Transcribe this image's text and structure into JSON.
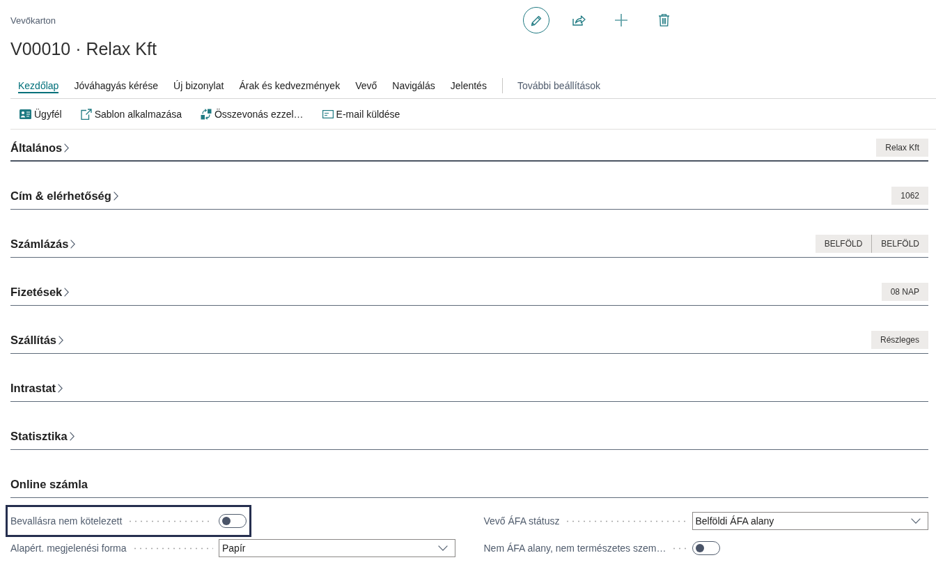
{
  "page": {
    "caption": "Vevőkarton",
    "title": "V00010 · Relax Kft"
  },
  "header_actions": [
    {
      "kind": "edit",
      "selected": true
    },
    {
      "kind": "share",
      "selected": false
    },
    {
      "kind": "new",
      "selected": false
    },
    {
      "kind": "delete",
      "selected": false
    }
  ],
  "tabs": [
    {
      "label": "Kezdőlap",
      "selected": true
    },
    {
      "label": "Jóváhagyás kérése",
      "selected": false
    },
    {
      "label": "Új bizonylat",
      "selected": false
    },
    {
      "label": "Árak és kedvezmények",
      "selected": false
    },
    {
      "label": "Vevő",
      "selected": false
    },
    {
      "label": "Navigálás",
      "selected": false
    },
    {
      "label": "Jelentés",
      "selected": false
    }
  ],
  "more_tab": {
    "label": "További beállítások"
  },
  "actions": [
    {
      "kind": "customer",
      "label": "Ügyfél"
    },
    {
      "kind": "template",
      "label": "Sablon alkalmazása"
    },
    {
      "kind": "merge",
      "label": "Összevonás ezzel…"
    },
    {
      "kind": "email",
      "label": "E-mail küldése"
    }
  ],
  "sections": [
    {
      "title": "Általános",
      "expanded": false,
      "selected": true,
      "summary": [
        "Relax Kft"
      ]
    },
    {
      "title": "Cím & elérhetőség",
      "expanded": false,
      "selected": false,
      "summary": [
        "1062"
      ]
    },
    {
      "title": "Számlázás",
      "expanded": false,
      "selected": false,
      "summary": [
        "BELFÖLD",
        "BELFÖLD"
      ]
    },
    {
      "title": "Fizetések",
      "expanded": false,
      "selected": false,
      "summary": [
        "08 NAP"
      ]
    },
    {
      "title": "Szállítás",
      "expanded": false,
      "selected": false,
      "summary": [
        "Részleges"
      ]
    },
    {
      "title": "Intrastat",
      "expanded": false,
      "selected": false
    },
    {
      "title": "Statisztika",
      "expanded": false,
      "selected": false
    },
    {
      "title": "Online számla",
      "expanded": true,
      "selected": false,
      "field_columns": [
        {
          "fields": [
            {
              "kind": "toggle",
              "label": "Bevallásra nem kötelezett",
              "on": false,
              "focused": true
            },
            {
              "kind": "select",
              "label": "Alapért. megjelenési forma",
              "value": "Papír",
              "focused": false
            }
          ]
        },
        {
          "fields": [
            {
              "kind": "select",
              "label": "Vevő ÁFA státusz",
              "value": "Belföldi ÁFA alany",
              "focused": false
            },
            {
              "kind": "toggle",
              "label": "Nem ÁFA alany, nem természetes szem…",
              "on": false,
              "focused": false
            }
          ]
        }
      ]
    }
  ]
}
